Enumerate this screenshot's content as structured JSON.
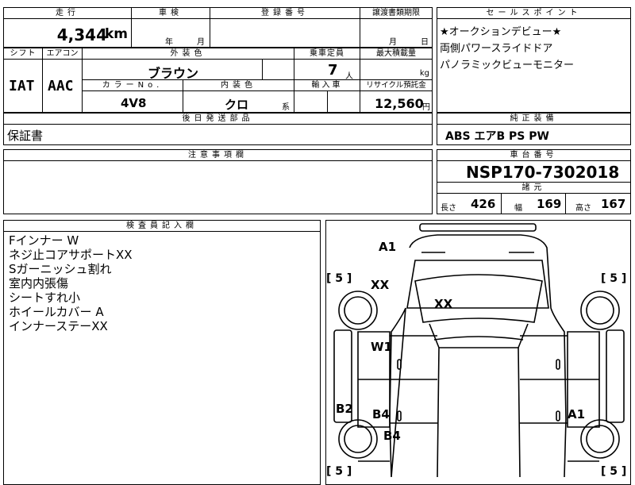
{
  "top_row": {
    "odometer_header": "走行",
    "odometer_value": "4,344",
    "odometer_unit": "km",
    "inspection_header": "車検",
    "inspection_year_unit": "年",
    "inspection_month_unit": "月",
    "registration_header": "登録番号",
    "transfer_header": "譲渡書類期限",
    "transfer_month_unit": "月",
    "transfer_day_unit": "日"
  },
  "sales_points": {
    "header": "セールスポイント",
    "lines": [
      "★オークションデビュー★",
      "両側パワースライドドア",
      "パノラミックビューモニター"
    ]
  },
  "spec_row": {
    "shift_header": "シフト",
    "shift_value": "IAT",
    "aircon_header": "エアコン",
    "aircon_value": "AAC",
    "exterior_header": "外装色",
    "exterior_value": "ブラウン",
    "capacity_header": "乗車定員",
    "capacity_value": "7",
    "capacity_unit": "人",
    "max_load_header": "最大積載量",
    "max_load_unit": "kg",
    "color_no_header": "カラーNo.",
    "color_no_value": "4V8",
    "interior_header": "内装色",
    "interior_value": "クロ",
    "interior_suffix": "系",
    "import_header": "輸入車",
    "recycle_header": "リサイクル預託金",
    "recycle_value": "12,560",
    "recycle_unit": "円"
  },
  "post_delivery": {
    "header": "後日発送部品",
    "value": "保証書"
  },
  "genuine_equipment": {
    "header": "純正装備",
    "value": "ABS エアB PS PW"
  },
  "caution": {
    "header": "注意事項欄"
  },
  "chassis": {
    "header": "車台番号",
    "value": "NSP170-7302018"
  },
  "dimensions": {
    "header": "諸元",
    "length_label": "長さ",
    "length_value": "426",
    "width_label": "幅",
    "width_value": "169",
    "height_label": "高さ",
    "height_value": "167"
  },
  "inspector_notes": {
    "header": "検査員記入欄",
    "lines": [
      "Fインナー W",
      "ネジ止コアサポートXX",
      "Sガーニッシュ割れ",
      "室内内張傷",
      "シートすれ小",
      "ホイールカバー A",
      "インナーステーXX"
    ]
  },
  "diagram": {
    "marks": {
      "a1_top": "A1",
      "xx_hood": "XX",
      "xx_front": "XX",
      "w1": "W1",
      "b2": "B2",
      "b4_left": "B4",
      "b4_wheel": "B4",
      "a1_right": "A1"
    },
    "tires": {
      "front_left": "[ 5 ]",
      "front_right": "[ 5 ]",
      "rear_left": "[ 5 ]",
      "rear_right": "[ 5 ]"
    }
  }
}
